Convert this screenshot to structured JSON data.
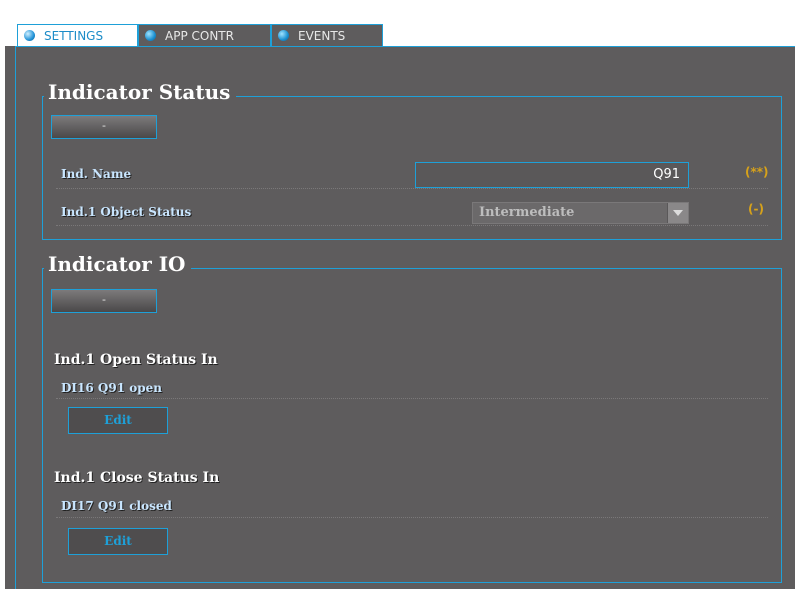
{
  "tabs": [
    {
      "label": "SETTINGS",
      "active": true
    },
    {
      "label": "APP CONTR",
      "active": false
    },
    {
      "label": "EVENTS",
      "active": false
    }
  ],
  "indicator_status": {
    "title": "Indicator Status",
    "collapse_label": "-",
    "name_label": "Ind. Name",
    "name_value": "Q91",
    "name_note": "(**)",
    "object_status_label": "Ind.1 Object Status",
    "object_status_value": "Intermediate",
    "object_status_note": "(-)"
  },
  "indicator_io": {
    "title": "Indicator IO",
    "collapse_label": "-",
    "open_status_title": "Ind.1 Open Status In",
    "open_status_value": "DI16 Q91 open",
    "open_edit_label": "Edit",
    "close_status_title": "Ind.1 Close Status In",
    "close_status_value": "DI17 Q91 closed",
    "close_edit_label": "Edit"
  },
  "colors": {
    "background": "#5e5c5d",
    "accent": "#1ea0d8",
    "warning_note": "#d7a21a"
  }
}
